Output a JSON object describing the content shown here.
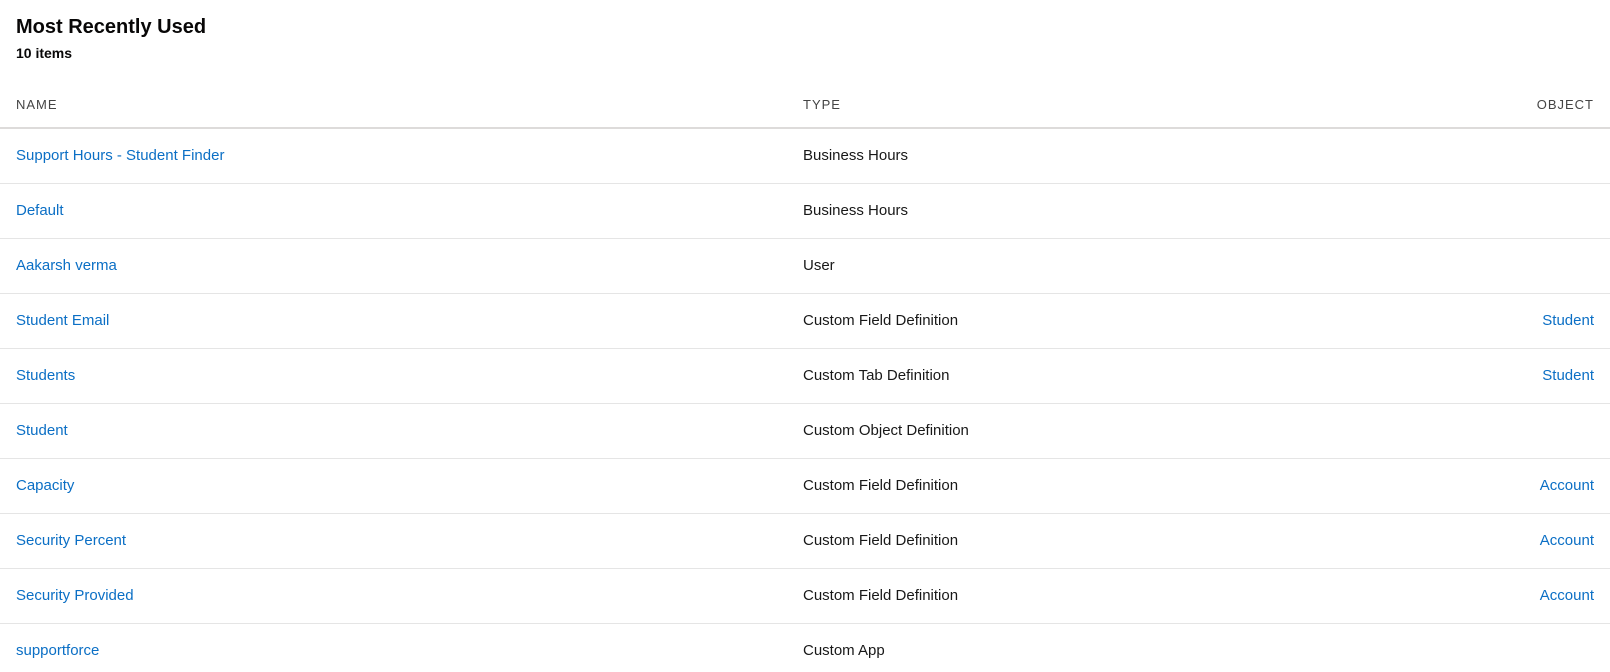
{
  "header": {
    "title": "Most Recently Used",
    "count": "10 items"
  },
  "columns": {
    "name": "NAME",
    "type": "TYPE",
    "object": "OBJECT"
  },
  "rows": [
    {
      "name": "Support Hours - Student Finder",
      "type": "Business Hours",
      "object": ""
    },
    {
      "name": "Default",
      "type": "Business Hours",
      "object": ""
    },
    {
      "name": "Aakarsh verma",
      "type": "User",
      "object": ""
    },
    {
      "name": "Student Email",
      "type": "Custom Field Definition",
      "object": "Student"
    },
    {
      "name": "Students",
      "type": "Custom Tab Definition",
      "object": "Student"
    },
    {
      "name": "Student",
      "type": "Custom Object Definition",
      "object": ""
    },
    {
      "name": "Capacity",
      "type": "Custom Field Definition",
      "object": "Account"
    },
    {
      "name": "Security Percent",
      "type": "Custom Field Definition",
      "object": "Account"
    },
    {
      "name": "Security Provided",
      "type": "Custom Field Definition",
      "object": "Account"
    },
    {
      "name": "supportforce",
      "type": "Custom App",
      "object": ""
    }
  ],
  "colors": {
    "link": "#0b6fc5",
    "text": "#181818",
    "header_text": "#444444",
    "divider": "#e5e5e5"
  }
}
